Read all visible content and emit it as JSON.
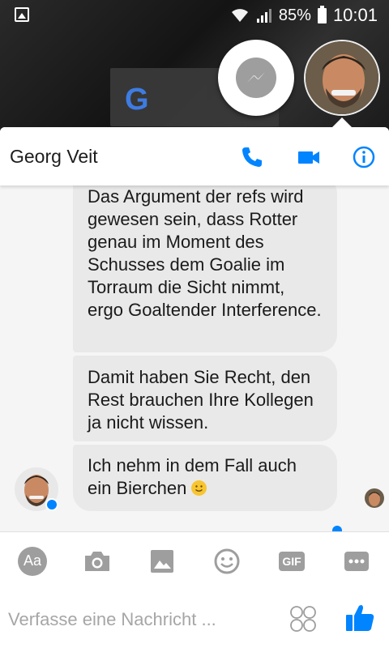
{
  "status_bar": {
    "battery_percent": "85%",
    "time": "10:01",
    "icons": [
      "gallery-notification-icon",
      "wifi-icon",
      "cellular-signal-icon",
      "battery-icon"
    ]
  },
  "home": {
    "widget_letter": "G"
  },
  "chat_heads": [
    "messenger-icon",
    "contact-avatar"
  ],
  "header": {
    "contact_name": "Georg Veit",
    "actions": [
      "phone-icon",
      "video-camera-icon",
      "info-icon"
    ]
  },
  "messages": [
    {
      "text": "Das Argument der refs wird gewesen sein, dass Rotter genau im Moment des Schusses dem Goalie im Torraum die Sicht nimmt, ergo Goaltender Interference."
    },
    {
      "text": "Damit haben Sie Recht, den Rest brauchen Ihre Kollegen ja nicht wissen."
    },
    {
      "text": "Ich nehm in dem Fall auch ein Bierchen",
      "emoji": "smiling-face-emoji"
    }
  ],
  "toolbar": {
    "text_label": "Aa",
    "gif_label": "GIF",
    "icons": [
      "text-format-icon",
      "camera-icon",
      "image-icon",
      "emoji-icon",
      "gif-icon",
      "more-icon"
    ]
  },
  "composer": {
    "placeholder": "Verfasse eine Nachricht ...",
    "value": "",
    "icons": [
      "sticker-icon",
      "like-icon"
    ]
  },
  "colors": {
    "accent": "#0084ff",
    "bubble": "#e9e9e9",
    "icon_gray": "#9e9e9e"
  }
}
